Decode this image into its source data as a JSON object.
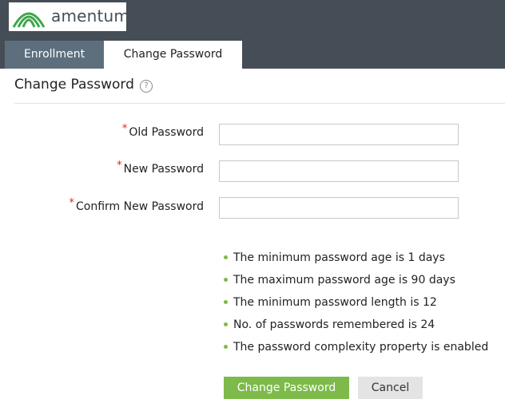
{
  "brand": {
    "name": "amentum",
    "logo_color": "#3fa64a"
  },
  "tabs": [
    {
      "label": "Enrollment",
      "active": false
    },
    {
      "label": "Change Password",
      "active": true
    }
  ],
  "page": {
    "title": "Change Password",
    "help_symbol": "?"
  },
  "form": {
    "required_mark": "*",
    "old_password_label": "Old Password",
    "new_password_label": "New Password",
    "confirm_password_label": "Confirm New Password",
    "old_password_value": "",
    "new_password_value": "",
    "confirm_password_value": ""
  },
  "policy": {
    "items": [
      "The minimum password age is 1 days",
      "The maximum password age is 90 days",
      "The minimum password length is 12",
      "No. of passwords remembered is 24",
      "The password complexity property is enabled"
    ]
  },
  "buttons": {
    "submit_label": "Change Password",
    "cancel_label": "Cancel"
  },
  "colors": {
    "header_bg": "#454e56",
    "tab_inactive_bg": "#5d6f7d",
    "accent_green": "#7dba4a",
    "required_red": "#e0261b"
  }
}
